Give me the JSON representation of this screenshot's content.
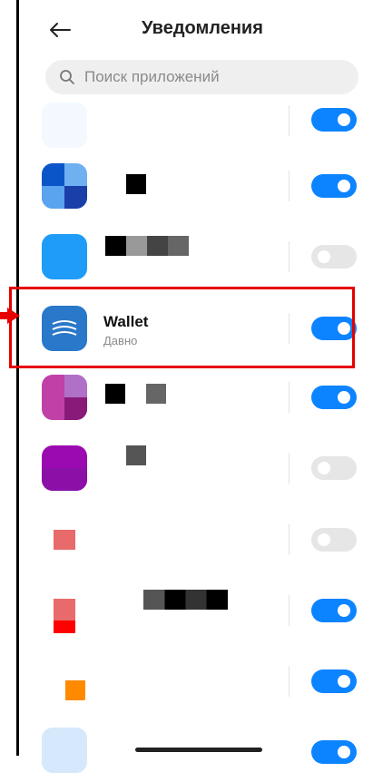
{
  "header": {
    "title": "Уведомления"
  },
  "search": {
    "placeholder": "Поиск приложений"
  },
  "apps": [
    {
      "name": "",
      "toggle": "on"
    },
    {
      "name": "",
      "toggle": "on"
    },
    {
      "name": "",
      "toggle": "off"
    },
    {
      "name": "Wallet",
      "subtitle": "Давно",
      "toggle": "on"
    },
    {
      "name": "",
      "toggle": "on"
    },
    {
      "name": "",
      "toggle": "off"
    },
    {
      "name": "",
      "toggle": "off"
    },
    {
      "name": "",
      "toggle": "on"
    },
    {
      "name": "",
      "toggle": "on"
    },
    {
      "name": "",
      "toggle": "on"
    }
  ],
  "colors": {
    "accent": "#0d84ff",
    "highlight": "#e60000",
    "toggle_off": "#e6e6e6"
  }
}
